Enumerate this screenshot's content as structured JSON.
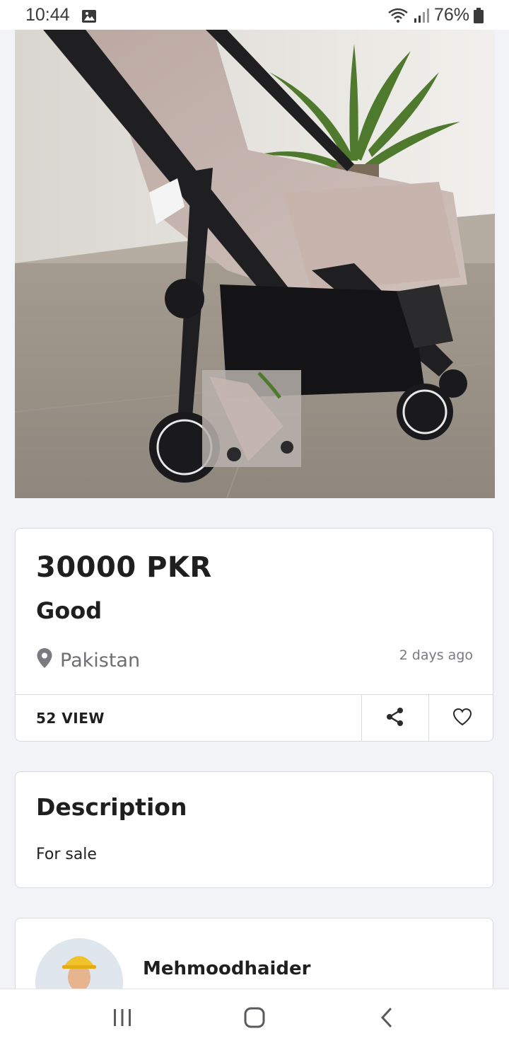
{
  "status_bar": {
    "time": "10:44",
    "battery": "76%"
  },
  "listing": {
    "price": "30000 PKR",
    "condition": "Good",
    "location": "Pakistan",
    "posted": "2 days ago",
    "views": "52 VIEW"
  },
  "description": {
    "title": "Description",
    "text": "For sale"
  },
  "seller": {
    "name": "Mehmoodhaider"
  },
  "icons": {
    "location": "location-pin-icon",
    "share": "share-icon",
    "like": "heart-icon",
    "nav_recent": "recent-apps-icon",
    "nav_home": "home-icon",
    "nav_back": "back-icon"
  },
  "colors": {
    "page_background": "#f2f3f6",
    "card_border": "#d9dbe0",
    "text_primary": "#1f1f1f",
    "text_secondary": "#6e6e73"
  }
}
